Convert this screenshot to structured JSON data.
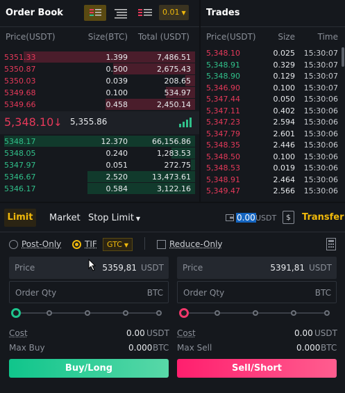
{
  "orderbook": {
    "title": "Order Book",
    "precision": "0.01",
    "headers": {
      "price": "Price(USDT)",
      "size": "Size(BTC)",
      "total": "Total (USDT)"
    },
    "asks": [
      {
        "price": "5351.33",
        "size": "1.399",
        "total": "7,486.51",
        "depth": 0.88
      },
      {
        "price": "5350.87",
        "size": "0.500",
        "total": "2,675.43",
        "depth": 0.42
      },
      {
        "price": "5350.03",
        "size": "0.039",
        "total": "208.65",
        "depth": 0.05
      },
      {
        "price": "5349.68",
        "size": "0.100",
        "total": "534.97",
        "depth": 0.15
      },
      {
        "price": "5349.66",
        "size": "0.458",
        "total": "2,450.14",
        "depth": 0.46
      }
    ],
    "last_price": "5,348.10",
    "mark_price": "5,355.86",
    "bids": [
      {
        "price": "5348.17",
        "size": "12.370",
        "total": "66,156.86",
        "depth": 0.98
      },
      {
        "price": "5348.05",
        "size": "0.240",
        "total": "1,283.53",
        "depth": 0.12
      },
      {
        "price": "5347.97",
        "size": "0.051",
        "total": "272.75",
        "depth": 0.02
      },
      {
        "price": "5346.67",
        "size": "2.520",
        "total": "13,473.61",
        "depth": 0.55
      },
      {
        "price": "5346.17",
        "size": "0.584",
        "total": "3,122.16",
        "depth": 0.55
      }
    ]
  },
  "trades": {
    "title": "Trades",
    "headers": {
      "price": "Price(USDT)",
      "size": "Size",
      "time": "Time"
    },
    "rows": [
      {
        "price": "5,348.10",
        "size": "0.025",
        "time": "15:30:07",
        "side": "sell"
      },
      {
        "price": "5,348.91",
        "size": "0.329",
        "time": "15:30:07",
        "side": "buy"
      },
      {
        "price": "5,348.90",
        "size": "0.129",
        "time": "15:30:07",
        "side": "buy"
      },
      {
        "price": "5,346.90",
        "size": "0.100",
        "time": "15:30:07",
        "side": "sell"
      },
      {
        "price": "5,347.44",
        "size": "0.050",
        "time": "15:30:06",
        "side": "sell"
      },
      {
        "price": "5,347.11",
        "size": "0.402",
        "time": "15:30:06",
        "side": "sell"
      },
      {
        "price": "5,347.23",
        "size": "2.594",
        "time": "15:30:06",
        "side": "sell"
      },
      {
        "price": "5,347.79",
        "size": "2.601",
        "time": "15:30:06",
        "side": "sell"
      },
      {
        "price": "5,348.35",
        "size": "2.446",
        "time": "15:30:06",
        "side": "sell"
      },
      {
        "price": "5,348.50",
        "size": "0.100",
        "time": "15:30:06",
        "side": "sell"
      },
      {
        "price": "5,348.53",
        "size": "0.019",
        "time": "15:30:06",
        "side": "sell"
      },
      {
        "price": "5,348.91",
        "size": "2.464",
        "time": "15:30:06",
        "side": "sell"
      },
      {
        "price": "5,349.47",
        "size": "2.566",
        "time": "15:30:06",
        "side": "sell"
      }
    ]
  },
  "order_form": {
    "tabs": [
      "Limit",
      "Market",
      "Stop Limit"
    ],
    "available": "0.00",
    "currency": "USDT",
    "transfer": "Transfer",
    "post_only": "Post-Only",
    "tif": "TIF",
    "tif_value": "GTC",
    "reduce_only": "Reduce-Only",
    "buy": {
      "price_label": "Price",
      "price_value": "5359,81",
      "price_unit": "USDT",
      "qty_label": "Order Qty",
      "qty_unit": "BTC",
      "cost_label": "Cost",
      "cost_value": "0.00",
      "cost_unit": "USDT",
      "max_label": "Max Buy",
      "max_value": "0.000",
      "max_unit": "BTC",
      "button": "Buy/Long"
    },
    "sell": {
      "price_label": "Price",
      "price_value": "5391,81",
      "price_unit": "USDT",
      "qty_label": "Order Qty",
      "qty_unit": "BTC",
      "cost_label": "Cost",
      "cost_value": "0.00",
      "cost_unit": "USDT",
      "max_label": "Max Sell",
      "max_value": "0.000",
      "max_unit": "BTC",
      "button": "Sell/Short"
    }
  },
  "colors": {
    "buy": "#1ec48c",
    "sell": "#f0376a",
    "accent": "#f0b90b"
  }
}
